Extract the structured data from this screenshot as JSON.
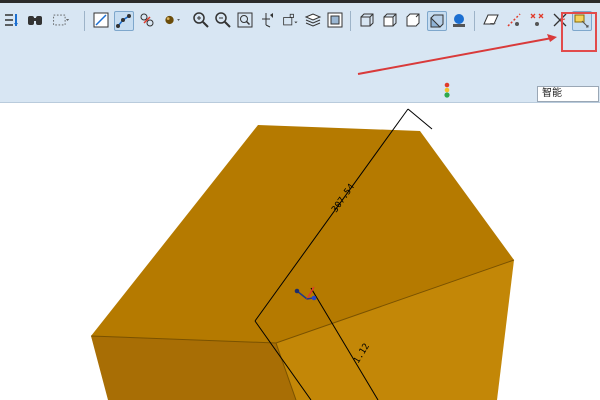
{
  "toolbar": {
    "icons": [
      "regenerate-icon",
      "find-icon",
      "select-box-icon",
      "datum-plane-display-icon",
      "datum-axis-display-icon",
      "datum-point-display-icon",
      "appearance-sphere-icon",
      "zoom-in-icon",
      "zoom-out-icon",
      "refit-icon",
      "orient-icon",
      "view-manager-icon",
      "layers-icon",
      "saved-views-icon",
      "wireframe-icon",
      "hidden-line-icon",
      "no-hidden-icon",
      "shading-icon",
      "shading-with-edges-icon",
      "plane-display-icon",
      "axis-display-icon",
      "point-display-icon",
      "csys-display-icon",
      "annotation-display-icon"
    ]
  },
  "filter": {
    "value": "智能"
  },
  "viewport": {
    "dimensions": [
      {
        "text": "307.54"
      },
      {
        "text": "1.12"
      }
    ],
    "colors": {
      "top": "#b57a00",
      "left": "#a86e05",
      "front": "#c38707",
      "edge": "#6f4a00",
      "dimension": "#000000"
    }
  }
}
